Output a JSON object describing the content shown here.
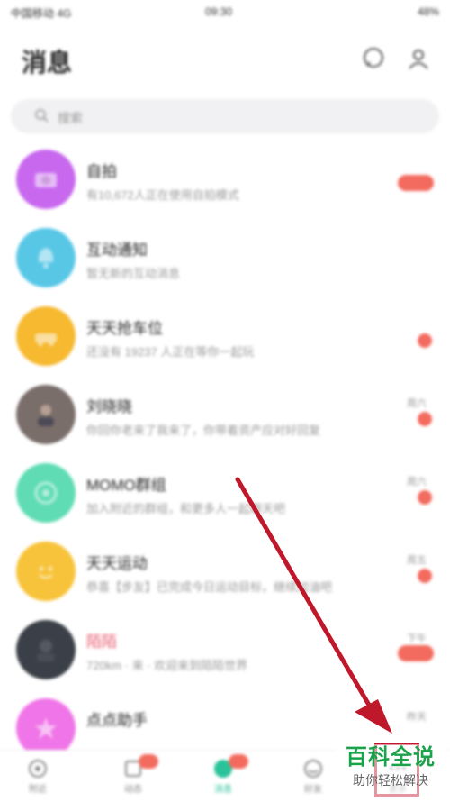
{
  "status_bar": {
    "carrier": "中国移动 4G",
    "time": "09:30",
    "battery": "48%"
  },
  "header": {
    "title": "消息"
  },
  "search": {
    "placeholder": "搜索"
  },
  "colors": {
    "accent_red": "#f36a5e",
    "accent_green": "#2bc39a",
    "highlight": "#c0182b",
    "watermark_green": "#1aa34a"
  },
  "conversations": [
    {
      "name": "自拍",
      "preview": "有10,672人正在使用自拍模式",
      "time": "",
      "indicator": "pill",
      "avatar_color": "#c868ee",
      "avatar_icon": "camera-icon"
    },
    {
      "name": "互动通知",
      "preview": "暂无新的互动消息",
      "time": "",
      "indicator": "none",
      "avatar_color": "#58c7e6",
      "avatar_icon": "bell-icon"
    },
    {
      "name": "天天抢车位",
      "preview": "还没有 19237 人正在等你一起玩",
      "time": "",
      "indicator": "dot",
      "avatar_color": "#f6b92f",
      "avatar_icon": "car-icon"
    },
    {
      "name": "刘晓晓",
      "preview": "你回你老来了我来了，你带着资产应对好回复",
      "time": "周六",
      "indicator": "dot",
      "avatar_color": "#7a6e6a",
      "avatar_icon": "person-icon"
    },
    {
      "name": "MOMO群组",
      "preview": "加入附近的群组，和更多人一起聊天吧",
      "time": "周六",
      "indicator": "dot",
      "avatar_color": "#5fdcb4",
      "avatar_icon": "group-icon"
    },
    {
      "name": "天天运动",
      "preview": "恭喜【步友】已完成今日运动目标，继续加油吧",
      "time": "周五",
      "indicator": "dot",
      "avatar_color": "#f7c33a",
      "avatar_icon": "smile-icon"
    },
    {
      "name": "陌陌",
      "preview": "720km · 来 · 欢迎来到陌陌世界",
      "time": "下午",
      "indicator": "pill",
      "avatar_color": "#3b4048",
      "avatar_icon": "person-icon",
      "name_red": true
    },
    {
      "name": "点点助手",
      "preview": "",
      "time": "昨天",
      "indicator": "none",
      "avatar_color": "#f075e8",
      "avatar_icon": "star-icon"
    }
  ],
  "tabbar": {
    "tabs": [
      {
        "label": "附近",
        "icon": "nearby-icon",
        "badge": false,
        "active": false
      },
      {
        "label": "动态",
        "icon": "feed-icon",
        "badge": true,
        "active": false
      },
      {
        "label": "消息",
        "icon": "message-icon",
        "badge": true,
        "active": true
      },
      {
        "label": "好友",
        "icon": "friends-icon",
        "badge": false,
        "active": false
      },
      {
        "label": "更多",
        "icon": "more-icon",
        "badge": false,
        "active": false
      }
    ]
  },
  "watermark": {
    "title": "百科全说",
    "subtitle": "助你轻松解决"
  }
}
